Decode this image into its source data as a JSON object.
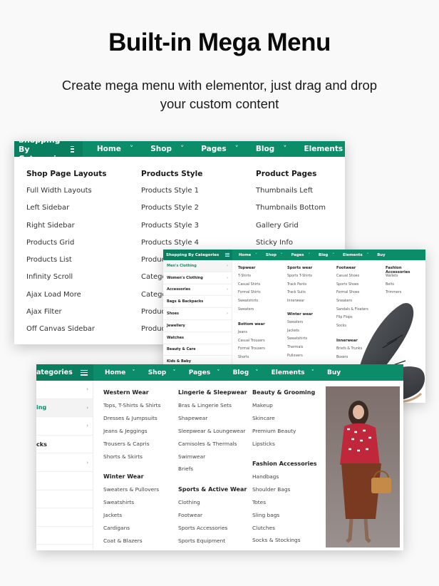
{
  "hero": {
    "title": "Built-in Mega Menu",
    "subtitle": "Create mega menu with elementor, just drag and drop your custom content"
  },
  "theme": {
    "accent": "#0c8d6a",
    "accent_dark": "#0a7f5f"
  },
  "card1": {
    "category_label": "Shopping By Categories",
    "nav": [
      "Home",
      "Shop",
      "Pages",
      "Blog",
      "Elements"
    ],
    "columns": [
      {
        "heading": "Shop Page Layouts",
        "items": [
          "Full Width Layouts",
          "Left Sidebar",
          "Right Sidebar",
          "Products Grid",
          "Products List",
          "Infinity Scroll",
          "Ajax Load More",
          "Ajax Filter",
          "Off Canvas Sidebar"
        ]
      },
      {
        "heading": "Products Style",
        "items": [
          "Products Style 1",
          "Products Style 2",
          "Products Style 3",
          "Products Style 4",
          "Produc",
          "Catego",
          "Catego",
          "Produc",
          "Produc"
        ]
      },
      {
        "heading": "Product Pages",
        "items": [
          "Thumbnails Left",
          "Thumbnails Bottom",
          "Gallery Grid",
          "Sticky Info"
        ]
      }
    ]
  },
  "card2": {
    "category_label": "Shopping By Categories",
    "nav": [
      "Home",
      "Shop",
      "Pages",
      "Blog",
      "Elements",
      "Buy"
    ],
    "sidebar": [
      {
        "label": "Men's Clothing",
        "arrow": true,
        "active": true
      },
      {
        "label": "Women's Clothing",
        "arrow": true
      },
      {
        "label": "Accessories",
        "arrow": true
      },
      {
        "label": "Bags & Backpacks",
        "arrow": false
      },
      {
        "label": "Shoes",
        "arrow": true
      },
      {
        "label": "Jewellery",
        "arrow": false
      },
      {
        "label": "Watches",
        "arrow": false
      },
      {
        "label": "Beauty & Care",
        "arrow": false
      },
      {
        "label": "Kids & Baby",
        "arrow": false
      }
    ],
    "groups": [
      {
        "heading": "Topwear",
        "items": [
          "T-Shirts",
          "Casual Shirts",
          "Formal Shirts",
          "Sweatshirts",
          "Sweaters"
        ]
      },
      {
        "heading": "Bottom wear",
        "items": [
          "Jeans",
          "Casual Trousers",
          "Formal Trousers",
          "Shorts"
        ]
      },
      {
        "heading": "Sports wear",
        "items": [
          "Sports T-Shirts",
          "Track Pants",
          "Track Suits",
          "Innerwear"
        ]
      },
      {
        "heading": "Winter wear",
        "items": [
          "Sweaters",
          "Jackets",
          "Sweatshirts",
          "Thermals",
          "Pullovers"
        ]
      },
      {
        "heading": "Footwear",
        "items": [
          "Casual Shoes",
          "Sports Shoes",
          "Formal Shoes",
          "Sneakers",
          "Sandals & Floaters",
          "Flip Flops",
          "Socks"
        ]
      },
      {
        "heading": "Innerwear",
        "items": [
          "Briefs & Trunks",
          "Boxers"
        ]
      },
      {
        "heading": "Fashion Accessories",
        "items": [
          "Wallets",
          "Belts",
          "Trimmers"
        ]
      }
    ],
    "image_alt": "Black leather shoes"
  },
  "card3": {
    "category_label": "ategories",
    "nav": [
      "Home",
      "Shop",
      "Pages",
      "Blog",
      "Elements",
      "Buy"
    ],
    "sidebar": [
      {
        "label": "",
        "arrow": true
      },
      {
        "label": "ing",
        "arrow": true,
        "active": true
      },
      {
        "label": "",
        "arrow": true
      },
      {
        "label": "cks",
        "arrow": false
      },
      {
        "label": "",
        "arrow": true
      },
      {
        "label": "",
        "arrow": false
      },
      {
        "label": "",
        "arrow": false
      },
      {
        "label": "",
        "arrow": false
      },
      {
        "label": "",
        "arrow": false
      }
    ],
    "groups": [
      {
        "heading": "Western Wear",
        "items": [
          "Tops, T-Shirts & Shirts",
          "Dresses & Jumpsuits",
          "Jeans & Jeggings",
          "Trousers & Capris",
          "Shorts & Skirts"
        ]
      },
      {
        "heading": "Winter Wear",
        "items": [
          "Sweaters & Pullovers",
          "Sweatshirts",
          "Jackets",
          "Cardigans",
          "Coat & Blazers"
        ]
      },
      {
        "heading": "Lingerie & Sleepwear",
        "items": [
          "Bras & Lingerie Sets",
          "Shapewear",
          "Sleepwear & Loungewear",
          "Camisoles & Thermals",
          "Swimwear",
          "Briefs"
        ]
      },
      {
        "heading": "Sports & Active Wear",
        "items": [
          "Clothing",
          "Footwear",
          "Sports Accessories",
          "Sports Equipment"
        ]
      },
      {
        "heading": "Beauty & Grooming",
        "items": [
          "Makeup",
          "Skincare",
          "Premium Beauty",
          "Lipsticks"
        ]
      },
      {
        "heading": "Fashion Accessories",
        "items": [
          "Handbags",
          "Shoulder Bags",
          "Totes",
          "Sling bags",
          "Clutches",
          "Socks & Stockings"
        ]
      }
    ],
    "image_alt": "Woman in red blouse and brown skirt holding handbag"
  }
}
